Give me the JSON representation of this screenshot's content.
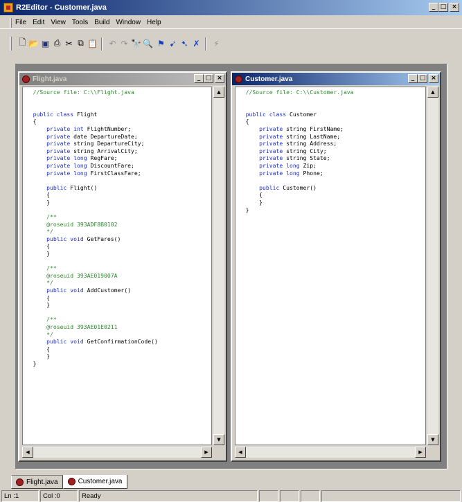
{
  "app": {
    "title": "R2Editor - Customer.java"
  },
  "menu": [
    "File",
    "Edit",
    "View",
    "Tools",
    "Build",
    "Window",
    "Help"
  ],
  "toolbar": {
    "buttons": [
      "new-file-icon",
      "open-folder-icon",
      "save-icon",
      "print-icon",
      "cut-icon",
      "copy-icon",
      "paste-icon",
      "undo-icon",
      "redo-icon",
      "find-icon",
      "find-next-icon",
      "bookmark-icon",
      "bookmark-next-icon",
      "bookmark-prev-icon",
      "bookmark-clear-icon",
      "build-icon"
    ]
  },
  "windows": [
    {
      "title": "Flight.java",
      "active": false,
      "lines": [
        [
          [
            "cm",
            "//Source file: C:\\\\Flight.java"
          ]
        ],
        [],
        [],
        [
          [
            "kw",
            "public class "
          ],
          [
            "n",
            "Flight"
          ]
        ],
        [
          [
            "n",
            "{"
          ]
        ],
        [
          [
            "kw",
            "    private int "
          ],
          [
            "n",
            "FlightNumber;"
          ]
        ],
        [
          [
            "kw",
            "    private "
          ],
          [
            "n",
            "date DepartureDate;"
          ]
        ],
        [
          [
            "kw",
            "    private "
          ],
          [
            "n",
            "string DepartureCity;"
          ]
        ],
        [
          [
            "kw",
            "    private "
          ],
          [
            "n",
            "string ArrivalCity;"
          ]
        ],
        [
          [
            "kw",
            "    private long "
          ],
          [
            "n",
            "RegFare;"
          ]
        ],
        [
          [
            "kw",
            "    private long "
          ],
          [
            "n",
            "DiscountFare;"
          ]
        ],
        [
          [
            "kw",
            "    private long "
          ],
          [
            "n",
            "FirstClassFare;"
          ]
        ],
        [],
        [
          [
            "kw",
            "    public "
          ],
          [
            "n",
            "Flight()"
          ]
        ],
        [
          [
            "n",
            "    {"
          ]
        ],
        [
          [
            "n",
            "    }"
          ]
        ],
        [],
        [
          [
            "cm",
            "    /**"
          ]
        ],
        [
          [
            "cm",
            "    @roseuid 393ADF8B0102"
          ]
        ],
        [
          [
            "cm",
            "    */"
          ]
        ],
        [
          [
            "kw",
            "    public void "
          ],
          [
            "n",
            "GetFares()"
          ]
        ],
        [
          [
            "n",
            "    {"
          ]
        ],
        [
          [
            "n",
            "    }"
          ]
        ],
        [],
        [
          [
            "cm",
            "    /**"
          ]
        ],
        [
          [
            "cm",
            "    @roseuid 393AE019007A"
          ]
        ],
        [
          [
            "cm",
            "    */"
          ]
        ],
        [
          [
            "kw",
            "    public void "
          ],
          [
            "n",
            "AddCustomer()"
          ]
        ],
        [
          [
            "n",
            "    {"
          ]
        ],
        [
          [
            "n",
            "    }"
          ]
        ],
        [],
        [
          [
            "cm",
            "    /**"
          ]
        ],
        [
          [
            "cm",
            "    @roseuid 393AE01E0211"
          ]
        ],
        [
          [
            "cm",
            "    */"
          ]
        ],
        [
          [
            "kw",
            "    public void "
          ],
          [
            "n",
            "GetConfirmationCode()"
          ]
        ],
        [
          [
            "n",
            "    {"
          ]
        ],
        [
          [
            "n",
            "    }"
          ]
        ],
        [
          [
            "n",
            "}"
          ]
        ]
      ]
    },
    {
      "title": "Customer.java",
      "active": true,
      "lines": [
        [
          [
            "cm",
            "//Source file: C:\\\\Customer.java"
          ]
        ],
        [],
        [],
        [
          [
            "kw",
            "public class "
          ],
          [
            "n",
            "Customer"
          ]
        ],
        [
          [
            "n",
            "{"
          ]
        ],
        [
          [
            "kw",
            "    private "
          ],
          [
            "n",
            "string FirstName;"
          ]
        ],
        [
          [
            "kw",
            "    private "
          ],
          [
            "n",
            "string LastName;"
          ]
        ],
        [
          [
            "kw",
            "    private "
          ],
          [
            "n",
            "string Address;"
          ]
        ],
        [
          [
            "kw",
            "    private "
          ],
          [
            "n",
            "string City;"
          ]
        ],
        [
          [
            "kw",
            "    private "
          ],
          [
            "n",
            "string State;"
          ]
        ],
        [
          [
            "kw",
            "    private long "
          ],
          [
            "n",
            "Zip;"
          ]
        ],
        [
          [
            "kw",
            "    private long "
          ],
          [
            "n",
            "Phone;"
          ]
        ],
        [],
        [
          [
            "kw",
            "    public "
          ],
          [
            "n",
            "Customer()"
          ]
        ],
        [
          [
            "n",
            "    {"
          ]
        ],
        [
          [
            "n",
            "    }"
          ]
        ],
        [
          [
            "n",
            "}"
          ]
        ]
      ]
    }
  ],
  "tabs": [
    "Flight.java",
    "Customer.java"
  ],
  "status": {
    "line": "Ln :1",
    "col": "Col :0",
    "message": "Ready"
  }
}
